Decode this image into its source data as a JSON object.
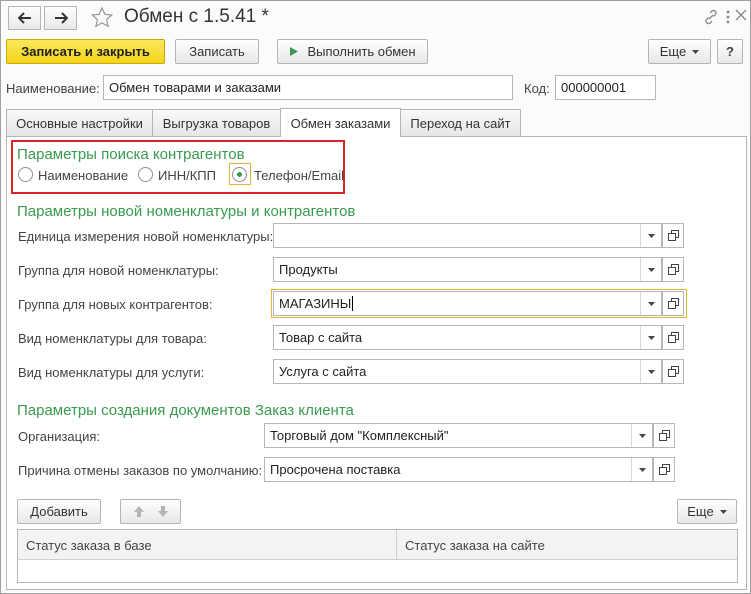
{
  "window": {
    "title": "Обмен с 1.5.41 *"
  },
  "toolbar": {
    "save_close_label": "Записать и закрыть",
    "save_label": "Записать",
    "run_exchange_label": "Выполнить обмен",
    "more_label": "Еще"
  },
  "form": {
    "name_label": "Наименование:",
    "name_value": "Обмен товарами и заказами",
    "code_label": "Код:",
    "code_value": "000000001"
  },
  "tabs": [
    {
      "label": "Основные настройки"
    },
    {
      "label": "Выгрузка товаров"
    },
    {
      "label": "Обмен заказами"
    },
    {
      "label": "Переход на сайт"
    }
  ],
  "active_tab": "Обмен заказами",
  "search": {
    "title": "Параметры поиска контрагентов",
    "options": [
      {
        "label": "Наименование"
      },
      {
        "label": "ИНН/КПП"
      },
      {
        "label": "Телефон/Email"
      }
    ],
    "selected": "Телефон/Email"
  },
  "nomenclature": {
    "title": "Параметры новой номенклатуры и контрагентов",
    "fields": [
      {
        "label": "Единица измерения новой номенклатуры:",
        "value": ""
      },
      {
        "label": "Группа для новой номенклатуры:",
        "value": "Продукты"
      },
      {
        "label": "Группа для новых контрагентов:",
        "value": "МАГАЗИНЫ"
      },
      {
        "label": "Вид номенклатуры для товара:",
        "value": "Товар с сайта"
      },
      {
        "label": "Вид номенклатуры для услуги:",
        "value": "Услуга с сайта"
      }
    ]
  },
  "orders": {
    "title": "Параметры создания документов Заказ клиента",
    "fields": [
      {
        "label": "Организация:",
        "value": "Торговый дом \"Комплексный\""
      },
      {
        "label": "Причина отмены заказов по умолчанию:",
        "value": "Просрочена поставка"
      }
    ]
  },
  "table_toolbar": {
    "add_label": "Добавить",
    "more_label": "Еще"
  },
  "table": {
    "columns": [
      "Статус заказа в базе",
      "Статус заказа на сайте"
    ]
  },
  "colors": {
    "accent_green": "#3a9a4f",
    "primary_button": "#f3d41a",
    "highlight_red": "#d9252a",
    "focus_border": "#e6b43a"
  }
}
